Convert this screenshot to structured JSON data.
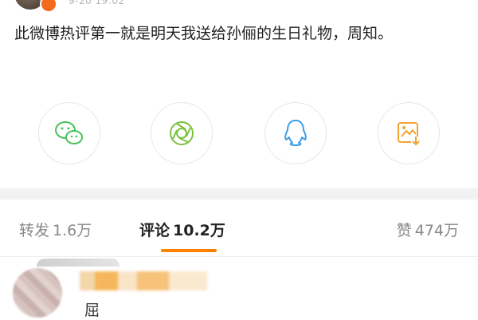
{
  "post": {
    "timestamp": "9-20 19:02",
    "text": "此微博热评第一就是明天我送给孙俪的生日礼物，周知。"
  },
  "share": {
    "items": [
      {
        "icon": "wechat-icon",
        "color": "#49c25a"
      },
      {
        "icon": "moments-icon",
        "color": "#7cc13f"
      },
      {
        "icon": "qq-icon",
        "color": "#3d9ee8"
      },
      {
        "icon": "save-image-icon",
        "color": "#f0a430"
      }
    ]
  },
  "tabs": {
    "repost": {
      "label": "转发",
      "count": "1.6万"
    },
    "comment": {
      "label": "评论",
      "count": "10.2万"
    },
    "like": {
      "label": "赞",
      "count": "474万"
    }
  },
  "colors": {
    "accent": "#ff8200"
  },
  "comment": {
    "first_char": "屈"
  }
}
